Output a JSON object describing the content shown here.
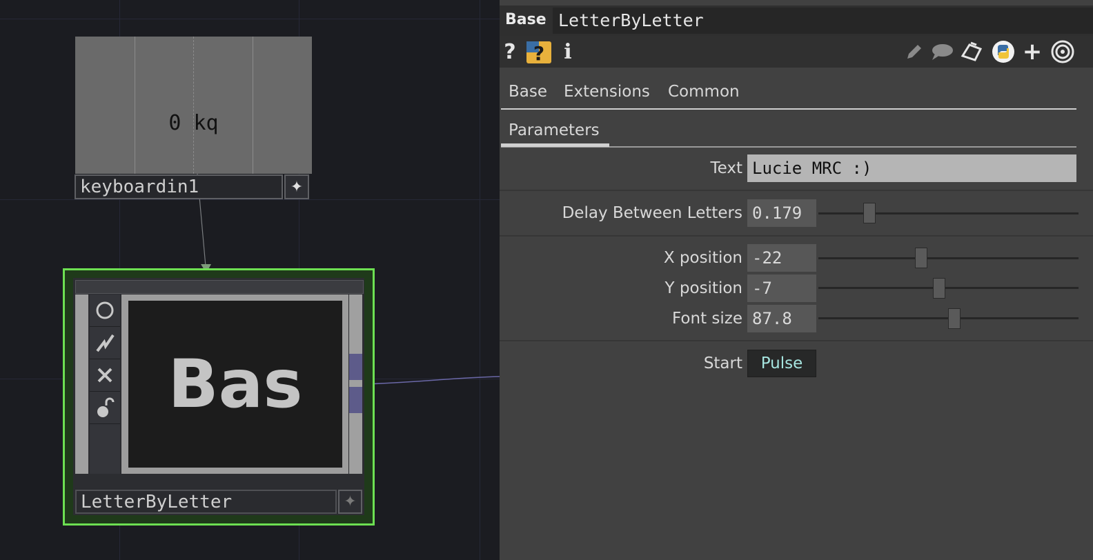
{
  "network": {
    "keyboard_node": {
      "viewer_text": "0 kq",
      "name": "keyboardin1",
      "button_icon": "sparkle-icon"
    },
    "base_node": {
      "viewer_text": "Bas",
      "name": "LetterByLetter",
      "button_icon": "sparkle-icon",
      "side_icons": [
        "circle-icon",
        "lightning-icon",
        "x-icon",
        "lock-icon"
      ],
      "selected_color": "#6de052"
    }
  },
  "panel": {
    "op_type": "Base",
    "op_name": "LetterByLetter",
    "toolbar_left": [
      "help-icon",
      "python-help-icon",
      "info-icon"
    ],
    "toolbar_right": [
      "edit-icon",
      "comment-icon",
      "clipboard-icon",
      "python-icon",
      "add-icon",
      "target-icon"
    ],
    "tabs": [
      "Base",
      "Extensions",
      "Common"
    ],
    "subtab": "Parameters",
    "params": {
      "text_label": "Text",
      "text_value": "Lucie MRC :)",
      "delay_label": "Delay Between Letters",
      "delay_value": "0.179",
      "xpos_label": "X position",
      "xpos_value": "-22",
      "ypos_label": "Y position",
      "ypos_value": "-7",
      "font_label": "Font size",
      "font_value": "87.8",
      "start_label": "Start",
      "start_button": "Pulse"
    },
    "accent_color": "#a6e5e0"
  }
}
